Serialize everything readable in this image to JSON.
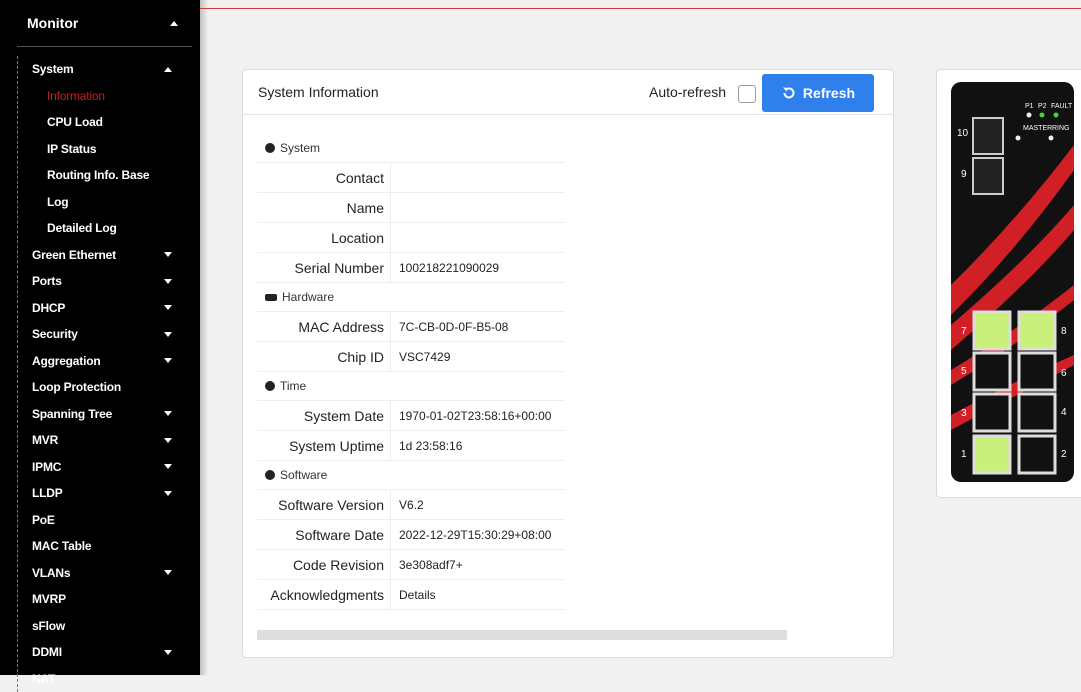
{
  "sidebar": {
    "header": "Monitor",
    "items": [
      {
        "label": "System",
        "level": "top",
        "caret": "up"
      },
      {
        "label": "Information",
        "level": "sub",
        "active": true
      },
      {
        "label": "CPU Load",
        "level": "sub"
      },
      {
        "label": "IP Status",
        "level": "sub"
      },
      {
        "label": "Routing Info. Base",
        "level": "sub"
      },
      {
        "label": "Log",
        "level": "sub"
      },
      {
        "label": "Detailed Log",
        "level": "sub"
      },
      {
        "label": "Green Ethernet",
        "level": "top",
        "caret": "down"
      },
      {
        "label": "Ports",
        "level": "top",
        "caret": "down"
      },
      {
        "label": "DHCP",
        "level": "top",
        "caret": "down"
      },
      {
        "label": "Security",
        "level": "top",
        "caret": "down"
      },
      {
        "label": "Aggregation",
        "level": "top",
        "caret": "down"
      },
      {
        "label": "Loop Protection",
        "level": "top"
      },
      {
        "label": "Spanning Tree",
        "level": "top",
        "caret": "down"
      },
      {
        "label": "MVR",
        "level": "top",
        "caret": "down"
      },
      {
        "label": "IPMC",
        "level": "top",
        "caret": "down"
      },
      {
        "label": "LLDP",
        "level": "top",
        "caret": "down"
      },
      {
        "label": "PoE",
        "level": "top"
      },
      {
        "label": "MAC Table",
        "level": "top"
      },
      {
        "label": "VLANs",
        "level": "top",
        "caret": "down"
      },
      {
        "label": "MVRP",
        "level": "top"
      },
      {
        "label": "sFlow",
        "level": "top"
      },
      {
        "label": "DDMI",
        "level": "top",
        "caret": "down"
      },
      {
        "label": "NAT",
        "level": "top"
      }
    ]
  },
  "panel": {
    "title": "System Information",
    "auto_refresh_label": "Auto-refresh",
    "refresh_label": "Refresh",
    "sections": [
      {
        "title": "System",
        "icon": "info-icon",
        "rows": [
          {
            "key": "Contact",
            "value": ""
          },
          {
            "key": "Name",
            "value": ""
          },
          {
            "key": "Location",
            "value": ""
          },
          {
            "key": "Serial Number",
            "value": "100218221090029"
          }
        ]
      },
      {
        "title": "Hardware",
        "icon": "hardware-icon",
        "rows": [
          {
            "key": "MAC Address",
            "value": "7C-CB-0D-0F-B5-08"
          },
          {
            "key": "Chip ID",
            "value": "VSC7429"
          }
        ]
      },
      {
        "title": "Time",
        "icon": "info-icon",
        "rows": [
          {
            "key": "System Date",
            "value": "1970-01-02T23:58:16+00:00"
          },
          {
            "key": "System Uptime",
            "value": "1d 23:58:16"
          }
        ]
      },
      {
        "title": "Software",
        "icon": "info-icon",
        "rows": [
          {
            "key": "Software Version",
            "value": "V6.2"
          },
          {
            "key": "Software Date",
            "value": "2022-12-29T15:30:29+08:00"
          },
          {
            "key": "Code Revision",
            "value": "3e308adf7+"
          },
          {
            "key": "Acknowledgments",
            "value": "Details",
            "link": true
          }
        ]
      }
    ]
  },
  "device": {
    "leds": [
      "P1",
      "P2",
      "FAULT",
      "MASTER",
      "RING"
    ],
    "port_labels": [
      "10",
      "9",
      "7",
      "8",
      "5",
      "6",
      "3",
      "4",
      "1",
      "2"
    ],
    "active_ports": [
      "7",
      "8",
      "1"
    ],
    "colors": {
      "active_port": "#c8f07a",
      "led_green": "#3fd63f",
      "stripe_red": "#d11f26"
    }
  }
}
